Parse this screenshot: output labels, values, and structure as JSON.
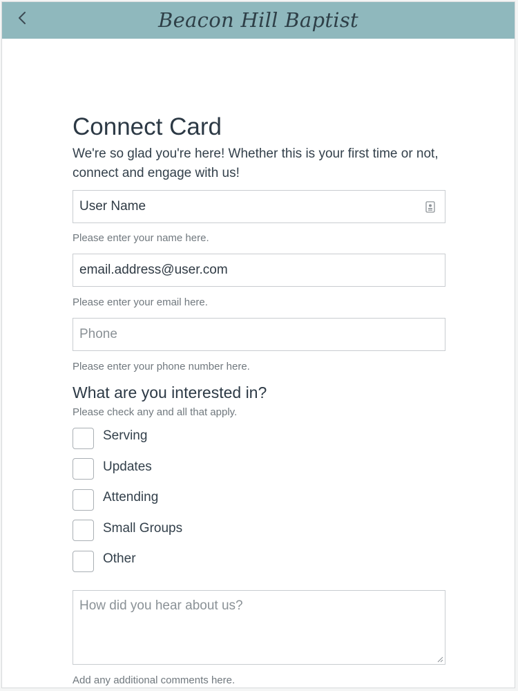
{
  "app": {
    "title": "Beacon Hill Baptist",
    "back_glyph": "<"
  },
  "colors": {
    "header_bg": "#8fb8bd",
    "text_primary": "#2c3945",
    "hint_text": "#70787e"
  },
  "page": {
    "title": "Connect Card",
    "intro": "We're so glad you're here! Whether this is your first time or not, connect and engage with us!"
  },
  "form": {
    "name": {
      "value": "User Name",
      "placeholder": "",
      "hint": "Please enter your name here.",
      "icon": "contact-card-icon"
    },
    "email": {
      "value": "email.address@user.com",
      "placeholder": "",
      "hint": "Please enter your email here."
    },
    "phone": {
      "value": "",
      "placeholder": "Phone",
      "hint": "Please enter your phone number here."
    },
    "interests": {
      "title": "What are you interested in?",
      "hint": "Please check any and all that apply.",
      "options": [
        {
          "label": "Serving",
          "checked": false
        },
        {
          "label": "Updates",
          "checked": false
        },
        {
          "label": "Attending",
          "checked": false
        },
        {
          "label": "Small Groups",
          "checked": false
        },
        {
          "label": "Other",
          "checked": false
        }
      ]
    },
    "comments": {
      "value": "",
      "placeholder": "How did you hear about us?",
      "hint": "Add any additional comments here."
    }
  }
}
